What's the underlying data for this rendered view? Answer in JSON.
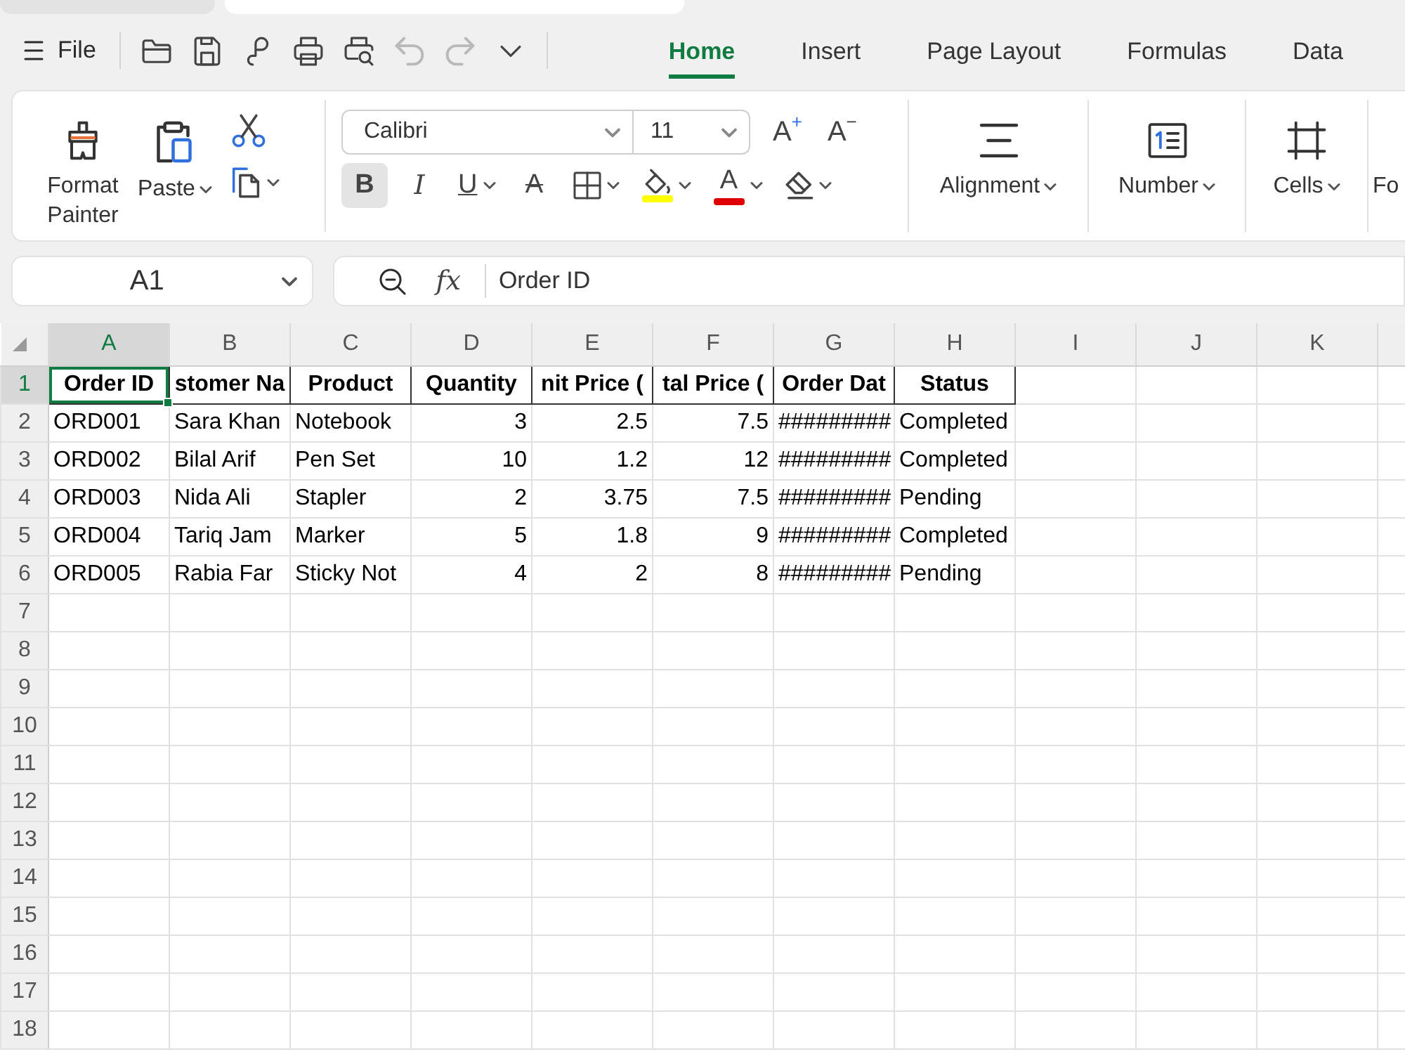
{
  "document_tabs": [
    {
      "selected": false
    },
    {
      "selected": true
    }
  ],
  "menu": {
    "label": "File"
  },
  "quick_access": [
    {
      "disabled": false
    },
    {
      "disabled": false
    },
    {
      "disabled": false
    },
    {
      "disabled": false
    },
    {
      "disabled": false
    },
    {
      "disabled": true
    },
    {
      "disabled": true
    },
    {
      "disabled": false
    }
  ],
  "ribbon_tabs": [
    {
      "label": "Home",
      "selected": true
    },
    {
      "label": "Insert",
      "selected": false
    },
    {
      "label": "Page Layout",
      "selected": false
    },
    {
      "label": "Formulas",
      "selected": false
    },
    {
      "label": "Data",
      "selected": false
    }
  ],
  "ribbon": {
    "clipboard": {
      "format_painter": "Format Painter",
      "paste": "Paste"
    },
    "font": {
      "name": "Calibri",
      "size": "11",
      "size_buttons": [
        "A$^{+}$",
        "A$^{−}$"
      ],
      "format_tools": [
        {
          "kind": "bold",
          "label": "B",
          "selected": true,
          "dropdown": false
        },
        {
          "kind": "italic",
          "label": "I",
          "selected": false,
          "dropdown": false
        },
        {
          "kind": "underline",
          "label": "U",
          "selected": false,
          "dropdown": true
        },
        {
          "kind": "strikethrough",
          "label": "A",
          "selected": false,
          "dropdown": false
        },
        {
          "kind": "borders",
          "selected": false,
          "dropdown": true
        },
        {
          "kind": "fill",
          "selected": false,
          "dropdown": true,
          "color": "#ffff00"
        },
        {
          "kind": "font-color",
          "label": "A",
          "selected": false,
          "dropdown": true,
          "color": "#e00000"
        },
        {
          "kind": "eraser",
          "selected": false,
          "dropdown": true
        }
      ]
    },
    "groups": [
      {
        "label": "Alignment"
      },
      {
        "label": "Number"
      },
      {
        "label": "Cells"
      },
      {
        "label": "Fo"
      }
    ]
  },
  "formula_bar": {
    "name_box": "A1",
    "function_label": "fx",
    "formula": "Order ID"
  },
  "sheet": {
    "columns": [
      {
        "label": "A",
        "selected": true,
        "kind": "text"
      },
      {
        "label": "B",
        "selected": false,
        "kind": "text"
      },
      {
        "label": "C",
        "selected": false,
        "kind": "text"
      },
      {
        "label": "D",
        "selected": false,
        "kind": "number"
      },
      {
        "label": "E",
        "selected": false,
        "kind": "number"
      },
      {
        "label": "F",
        "selected": false,
        "kind": "number"
      },
      {
        "label": "G",
        "selected": false,
        "kind": "text"
      },
      {
        "label": "H",
        "selected": false,
        "kind": "text"
      },
      {
        "label": "I",
        "selected": false
      },
      {
        "label": "J",
        "selected": false
      },
      {
        "label": "K",
        "selected": false
      }
    ],
    "rows": [
      {
        "label": "1",
        "selected": true,
        "header": true,
        "cells": [
          "Order ID",
          "stomer Na",
          "Product",
          "Quantity",
          "nit Price (",
          "tal Price (",
          "Order Dat",
          "Status"
        ]
      },
      {
        "label": "2",
        "selected": false,
        "header": false,
        "cells": [
          "ORD001",
          "Sara Khan",
          "Notebook",
          "3",
          "2.5",
          "7.5",
          "#########",
          "Completed"
        ]
      },
      {
        "label": "3",
        "selected": false,
        "header": false,
        "cells": [
          "ORD002",
          "Bilal Arif",
          "Pen Set",
          "10",
          "1.2",
          "12",
          "#########",
          "Completed"
        ]
      },
      {
        "label": "4",
        "selected": false,
        "header": false,
        "cells": [
          "ORD003",
          "Nida Ali",
          "Stapler",
          "2",
          "3.75",
          "7.5",
          "#########",
          "Pending"
        ]
      },
      {
        "label": "5",
        "selected": false,
        "header": false,
        "cells": [
          "ORD004",
          "Tariq Jam",
          "Marker",
          "5",
          "1.8",
          "9",
          "#########",
          "Completed"
        ]
      },
      {
        "label": "6",
        "selected": false,
        "header": false,
        "cells": [
          "ORD005",
          "Rabia Far",
          "Sticky Not",
          "4",
          "2",
          "8",
          "#########",
          "Pending"
        ]
      },
      {
        "label": "7",
        "selected": false
      },
      {
        "label": "8",
        "selected": false
      },
      {
        "label": "9",
        "selected": false
      },
      {
        "label": "10",
        "selected": false
      },
      {
        "label": "11",
        "selected": false
      },
      {
        "label": "12",
        "selected": false
      },
      {
        "label": "13",
        "selected": false
      },
      {
        "label": "14",
        "selected": false
      },
      {
        "label": "15",
        "selected": false
      },
      {
        "label": "16",
        "selected": false
      },
      {
        "label": "17",
        "selected": false
      },
      {
        "label": "18",
        "selected": false
      }
    ]
  }
}
